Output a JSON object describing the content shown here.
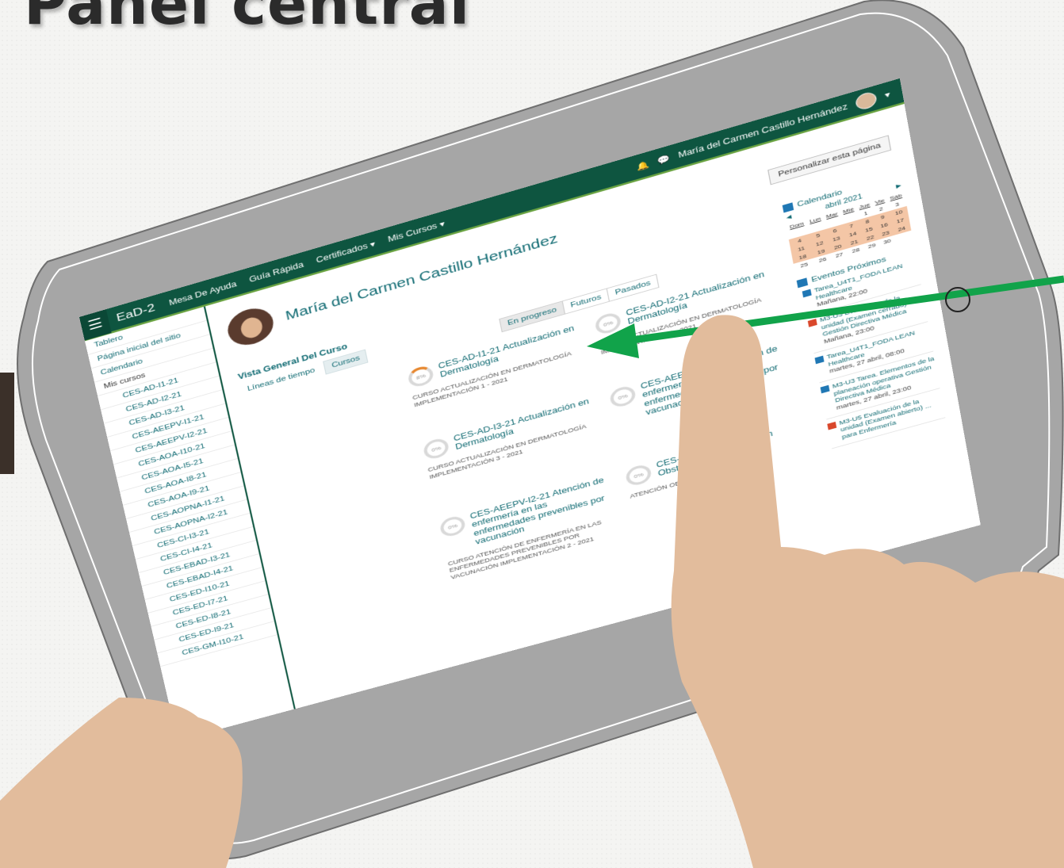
{
  "slide": {
    "title": "Panel central"
  },
  "navbar": {
    "brand": "EaD-2",
    "items": [
      "Mesa De Ayuda",
      "Guía Rápida",
      "Certificados ▾",
      "Mis Cursos ▾"
    ],
    "user_name": "María del Carmen Castillo Hernández",
    "bell_icon": "bell-icon",
    "chat_icon": "chat-icon"
  },
  "drawer": {
    "items": [
      "Tablero",
      "Página inicial del sitio",
      "Calendario"
    ],
    "my_courses_label": "Mis cursos",
    "courses": [
      "CES-AD-I1-21",
      "CES-AD-I2-21",
      "CES-AD-I3-21",
      "CES-AEEPV-I1-21",
      "CES-AEEPV-I2-21",
      "CES-AOA-I10-21",
      "CES-AOA-I5-21",
      "CES-AOA-I8-21",
      "CES-AOA-I9-21",
      "CES-AOPNA-I1-21",
      "CES-AOPNA-I2-21",
      "CES-CI-I3-21",
      "CES-CI-I4-21",
      "CES-EBAD-I3-21",
      "CES-EBAD-I4-21",
      "CES-ED-I10-21",
      "CES-ED-I7-21",
      "CES-ED-I8-21",
      "CES-ED-I9-21",
      "CES-GM-I10-21"
    ]
  },
  "main": {
    "profile_name": "María del Carmen Castillo Hernández",
    "customize_button": "Personalizar esta página",
    "overview_title": "Vista General Del Curso",
    "view_tabs": [
      "Líneas de tiempo",
      "Cursos"
    ],
    "filter_tabs": [
      "En progreso",
      "Futuros",
      "Pasados"
    ]
  },
  "courses": [
    {
      "title": "CES-AD-I1-21 Actualización en Dermatología",
      "category": "CURSO ACTUALIZACIÓN EN DERMATOLOGÍA IMPLEMENTACIÓN 1 - 2021",
      "progress": "8%"
    },
    {
      "title": "CES-AD-I2-21 Actualización en Dermatología",
      "category": "CURSO ACTUALIZACIÓN EN DERMATOLOGÍA IMPLEMENTACIÓN 2 - 2021",
      "progress": "0%"
    },
    {
      "title": "CES-AD-I3-21 Actualización en Dermatología",
      "category": "CURSO ACTUALIZACIÓN EN DERMATOLOGÍA IMPLEMENTACIÓN 3 - 2021",
      "progress": "0%"
    },
    {
      "title": "CES-AEEPV-I1-21 Atención de enfermería en las enfermedades prevenibles por vacunación",
      "category": "",
      "progress": "0%"
    },
    {
      "title": "CES-AEEPV-I2-21 Atención de enfermería en las enfermedades prevenibles por vacunación",
      "category": "CURSO ATENCIÓN DE ENFERMERÍA EN LAS ENFERMEDADES PREVENIBLES POR VACUNACIÓN IMPLEMENTACIÓN 2 - 2021",
      "progress": "0%"
    },
    {
      "title": "CES-AOA-I10-21 Atención Obstétrica Amigable",
      "category": "ATENCIÓN OBSTÉTRICA ... 10 - 2021",
      "progress": "0%"
    }
  ],
  "calendar": {
    "title": "Calendario",
    "month": "abril 2021",
    "weekdays": [
      "Dom",
      "Lun",
      "Mar",
      "Mié",
      "Jue",
      "Vie",
      "Sáb"
    ],
    "weeks": [
      [
        "",
        "",
        "",
        "",
        "1",
        "2",
        "3"
      ],
      [
        "4",
        "5",
        "6",
        "7",
        "8",
        "9",
        "10"
      ],
      [
        "11",
        "12",
        "13",
        "14",
        "15",
        "16",
        "17"
      ],
      [
        "18",
        "19",
        "20",
        "21",
        "22",
        "23",
        "24"
      ],
      [
        "25",
        "26",
        "27",
        "28",
        "29",
        "30",
        ""
      ]
    ]
  },
  "events": {
    "title": "Eventos Próximos",
    "items": [
      {
        "name": "Tarea_U4T1_FODA LEAN Healthcare",
        "date": "Mañana, 22:00",
        "type": "blue"
      },
      {
        "name": "M3-U3 Evaluación de la unidad (Examen cerrado) Gestión Directiva Médica",
        "date": "Mañana, 23:00",
        "type": "red"
      },
      {
        "name": "Tarea_U4T1_FODA LEAN Healthcare",
        "date": "martes, 27 abril, 08:00",
        "type": "blue"
      },
      {
        "name": "M3-U3 Tarea. Elementos de la planeación operativa Gestión Directiva Médica",
        "date": "martes, 27 abril, 23:00",
        "type": "blue"
      },
      {
        "name": "M3-U5 Evaluación de la unidad (Examen abierto) ... para Enfermería",
        "date": "",
        "type": "red"
      }
    ]
  },
  "colors": {
    "navbar": "#0e5540",
    "accent": "#0f6a72",
    "arrow": "#11a34a",
    "tablet_frame": "#a8a8a8",
    "hand": "#e2bc9c"
  }
}
